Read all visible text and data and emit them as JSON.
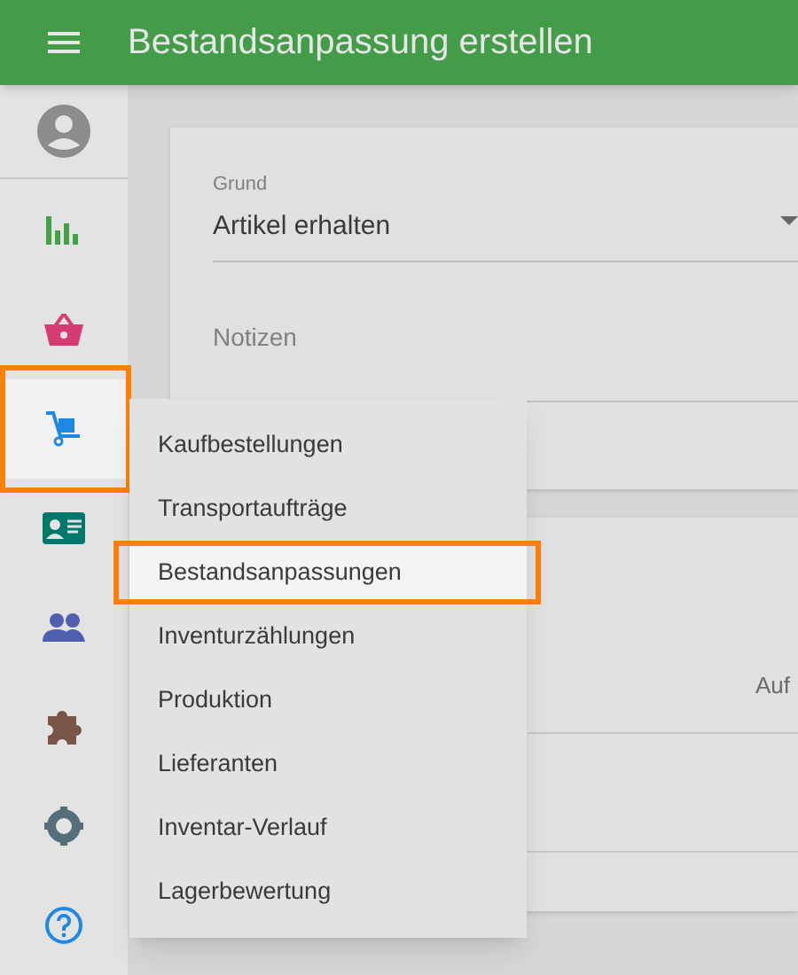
{
  "app_bar": {
    "title": "Bestandsanpassung erstellen"
  },
  "sidebar": {
    "items": [
      {
        "selected": false,
        "highlighted": false
      },
      {
        "selected": false,
        "highlighted": false
      },
      {
        "selected": true,
        "highlighted": true
      },
      {
        "selected": false,
        "highlighted": false
      },
      {
        "selected": false,
        "highlighted": false
      },
      {
        "selected": false,
        "highlighted": false
      },
      {
        "selected": false,
        "highlighted": false
      },
      {
        "selected": false,
        "highlighted": false
      }
    ]
  },
  "form": {
    "reason": {
      "label": "Grund",
      "value": "Artikel erhalten"
    },
    "notes": {
      "label": "Notizen"
    }
  },
  "card_2": {
    "column_1": "Auf"
  },
  "menu": {
    "items": [
      {
        "label": "Kaufbestellungen",
        "selected": false,
        "highlighted": false
      },
      {
        "label": "Transportaufträge",
        "selected": false,
        "highlighted": false
      },
      {
        "label": "Bestandsanpassungen",
        "selected": true,
        "highlighted": true
      },
      {
        "label": "Inventurzählungen",
        "selected": false,
        "highlighted": false
      },
      {
        "label": "Produktion",
        "selected": false,
        "highlighted": false
      },
      {
        "label": "Lieferanten",
        "selected": false,
        "highlighted": false
      },
      {
        "label": "Inventar-Verlauf",
        "selected": false,
        "highlighted": false
      },
      {
        "label": "Lagerbewertung",
        "selected": false,
        "highlighted": false
      }
    ]
  }
}
